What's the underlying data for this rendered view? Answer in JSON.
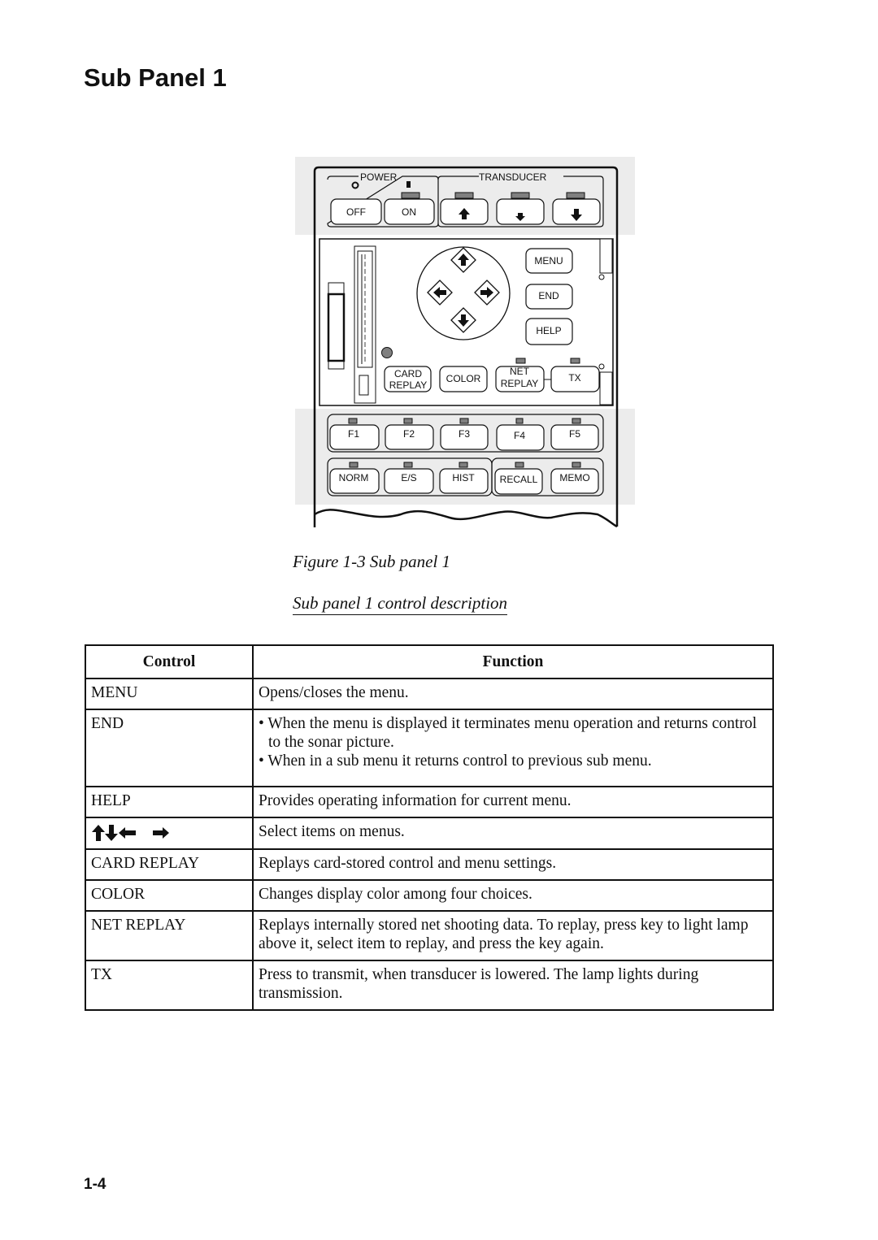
{
  "page": {
    "title": "Sub Panel 1",
    "page_number": "1-4"
  },
  "figure": {
    "caption": "Figure 1-3 Sub panel 1",
    "panel": {
      "group_labels": {
        "power": "POWER",
        "transducer": "TRANSDUCER"
      },
      "power_buttons": [
        "OFF",
        "ON"
      ],
      "transducer_buttons": [
        {
          "icon": "arrow-up-icon"
        },
        {
          "icon": "arrow-down-small-icon"
        },
        {
          "icon": "arrow-down-icon"
        }
      ],
      "menu_buttons": [
        "MENU",
        "END",
        "HELP"
      ],
      "mid_buttons": [
        {
          "line1": "CARD",
          "line2": "REPLAY"
        },
        {
          "line1": "COLOR",
          "line2": ""
        },
        {
          "line1": "NET",
          "line2": "REPLAY"
        },
        {
          "line1": "TX",
          "line2": ""
        }
      ],
      "function_keys": [
        "F1",
        "F2",
        "F3",
        "F4",
        "F5"
      ],
      "mode_keys": [
        "NORM",
        "E/S",
        "HIST",
        "RECALL",
        "MEMO"
      ]
    }
  },
  "section": {
    "title": "Sub panel 1 control description"
  },
  "table": {
    "headers": {
      "control": "Control",
      "function": "Function"
    },
    "rows": [
      {
        "control": "MENU",
        "function": [
          "Opens/closes the menu."
        ]
      },
      {
        "control": "END",
        "bullets": [
          "• When the menu is displayed it terminates menu operation and returns control to the sonar picture.",
          "• When in a sub menu it returns control to previous sub menu."
        ]
      },
      {
        "control": "HELP",
        "function": [
          "Provides operating information for current menu."
        ]
      },
      {
        "control": "arrow-keys",
        "icons": [
          "arrow-up-icon",
          "arrow-down-icon",
          "arrow-left-icon",
          "arrow-right-icon"
        ],
        "function": [
          "Select items on menus."
        ]
      },
      {
        "control": "CARD REPLAY",
        "function": [
          "Replays card-stored control and menu settings."
        ]
      },
      {
        "control": "COLOR",
        "function": [
          "Changes display color among four choices."
        ]
      },
      {
        "control": "NET REPLAY",
        "function": [
          "Replays internally stored net shooting data. To replay, press key to light lamp above it, select item to replay, and press the key again."
        ]
      },
      {
        "control": "TX",
        "function": [
          "Press to transmit, when transducer is lowered. The lamp lights during transmission."
        ]
      }
    ]
  }
}
